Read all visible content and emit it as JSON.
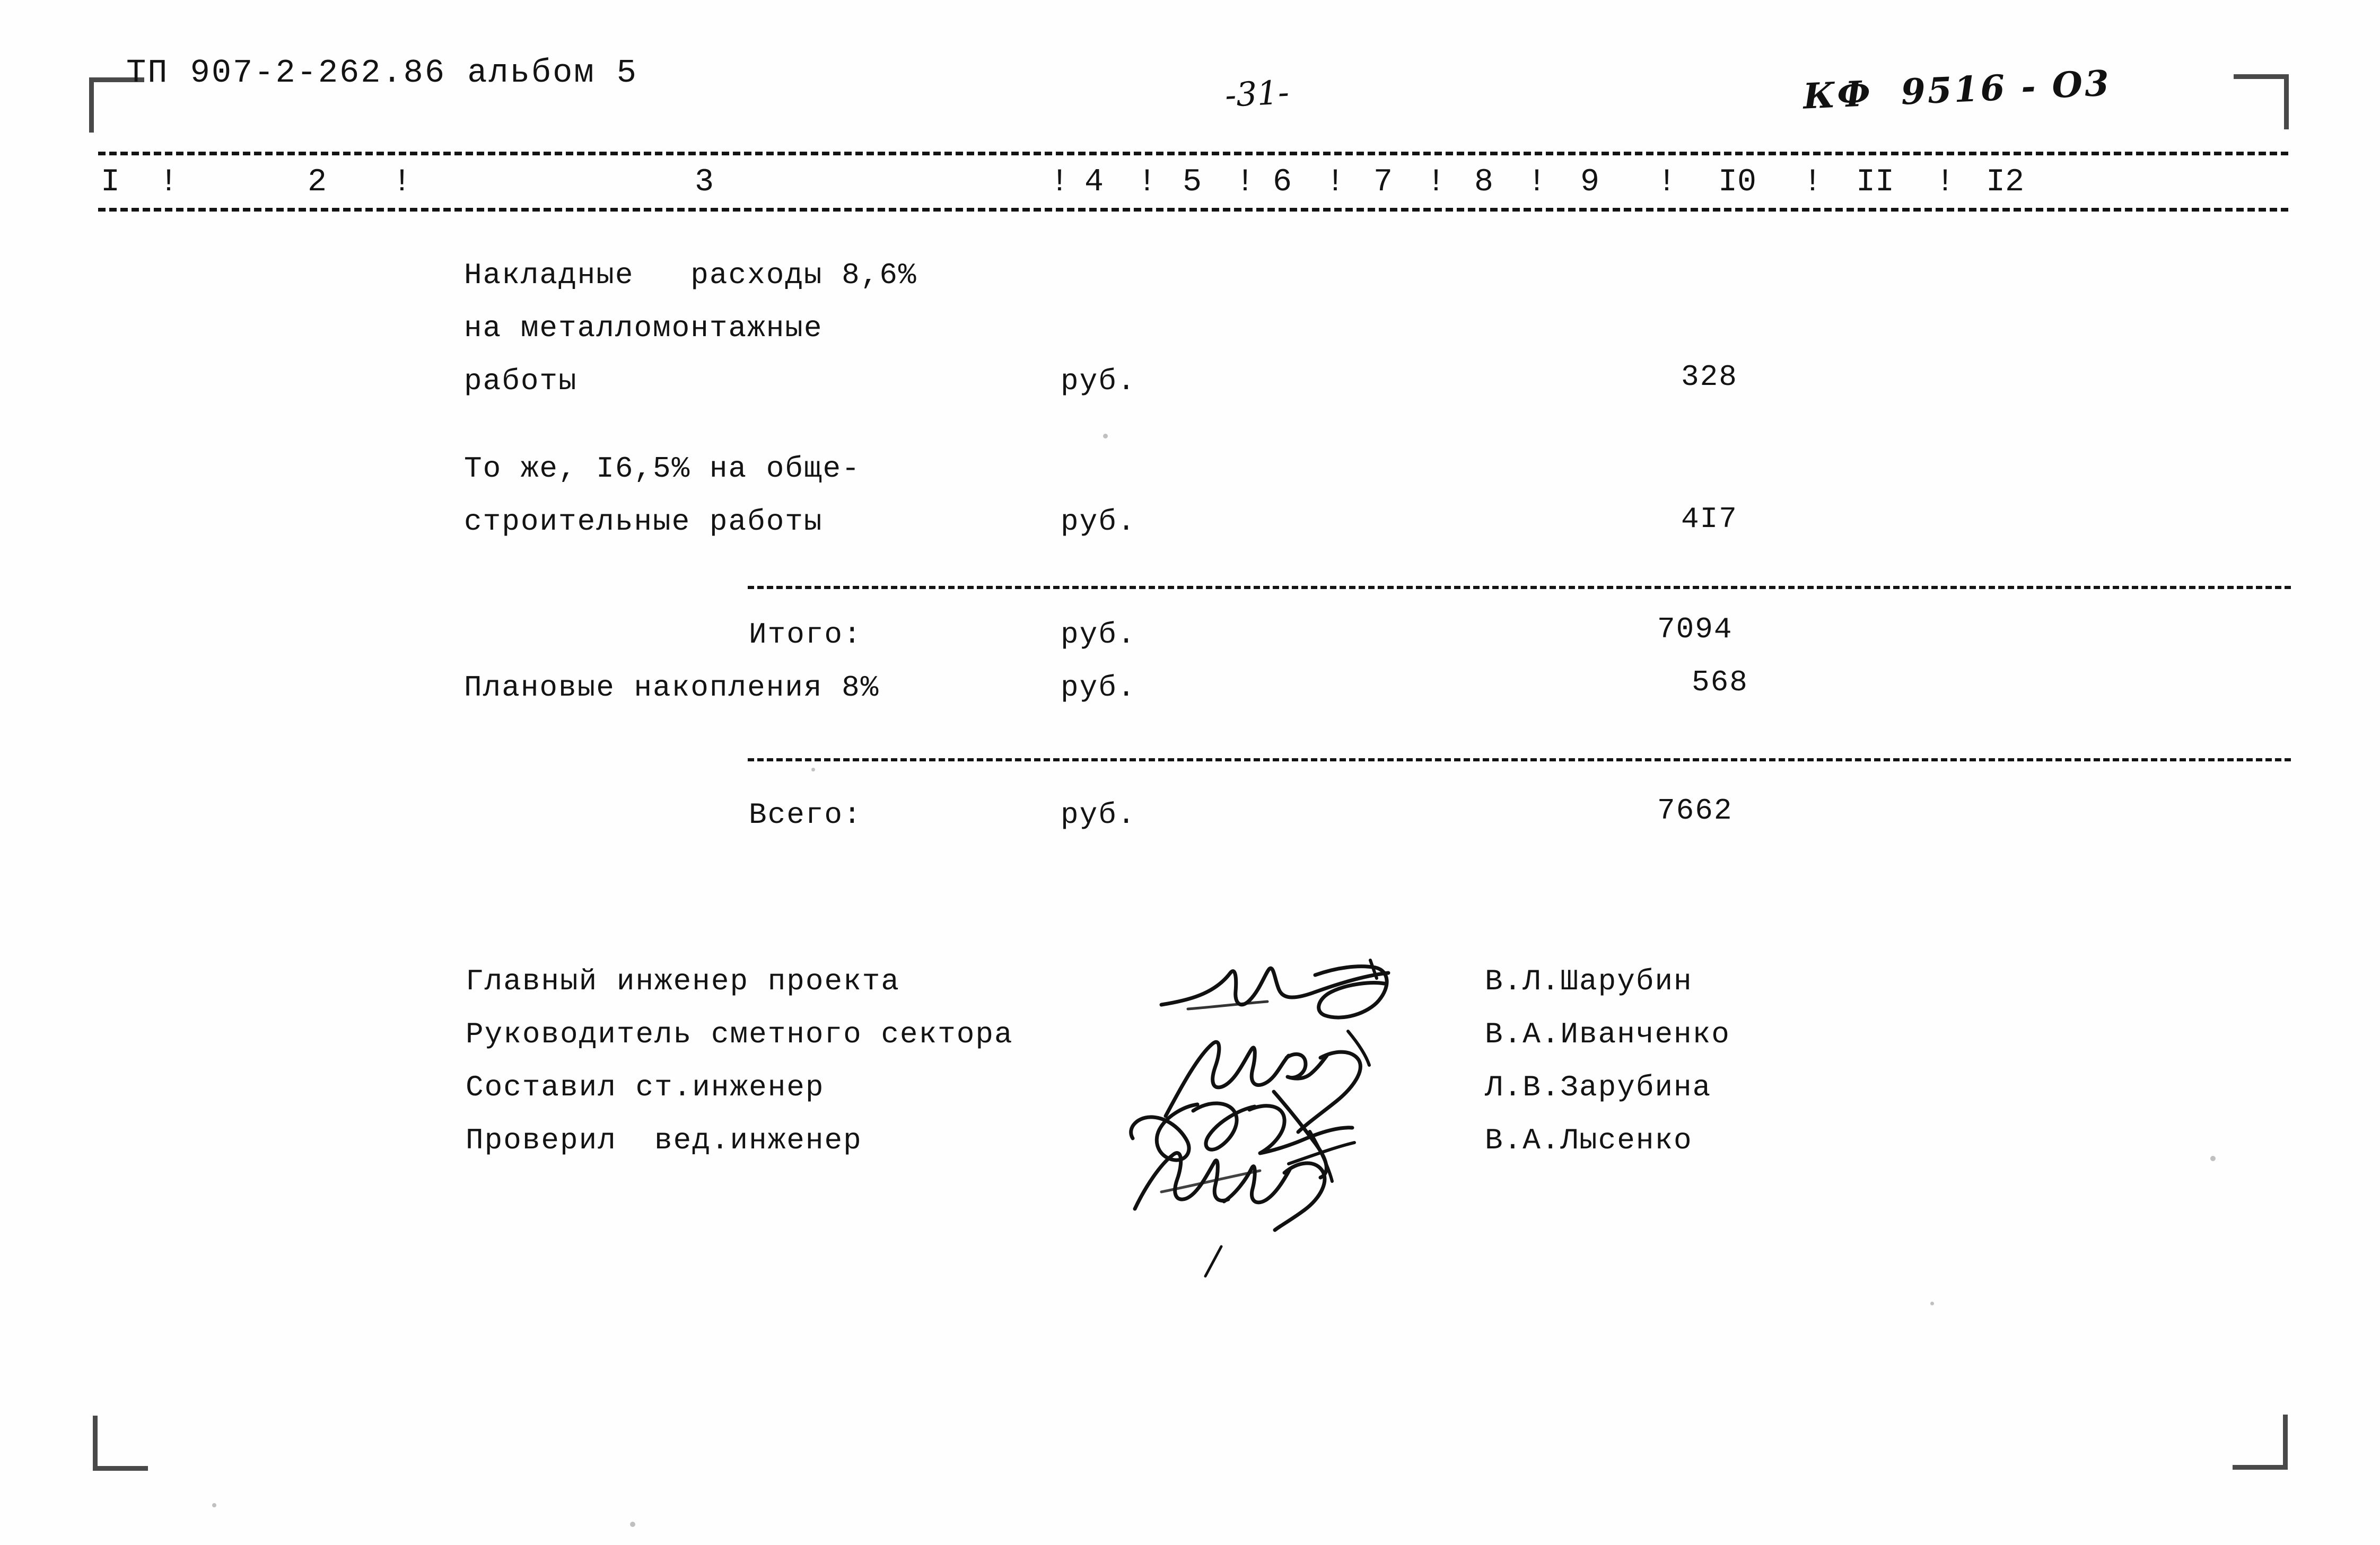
{
  "document": {
    "header_code": "ТП 907-2-262.86 альбом 5",
    "page_number": "-31-",
    "archive_code": "КФ  9516 - О3"
  },
  "table": {
    "column_numbers": [
      "I",
      "2",
      "3",
      "4",
      "5",
      "6",
      "7",
      "8",
      "9",
      "I0",
      "II",
      "I2"
    ],
    "separator": "!",
    "rows": [
      {
        "name": "overhead-metal",
        "description_lines": [
          "Накладные   расходы 8,6%",
          "на металломонтажные",
          "работы"
        ],
        "unit": "руб.",
        "value": "328"
      },
      {
        "name": "overhead-general-construction",
        "description_lines": [
          "То же, I6,5% на обще-",
          "строительные работы"
        ],
        "unit": "руб.",
        "value": "4I7"
      }
    ],
    "subtotal": {
      "label": "Итого:",
      "unit": "руб.",
      "value": "7094"
    },
    "planned_savings": {
      "label": "Плановые накопления 8%",
      "unit": "руб.",
      "value": "568"
    },
    "total": {
      "label": "Всего:",
      "unit": "руб.",
      "value": "7662"
    }
  },
  "signatures": [
    {
      "role": "Главный инженер проекта",
      "person": "В.Л.Шарубин"
    },
    {
      "role": "Руководитель сметного сектора",
      "person": "В.А.Иванченко"
    },
    {
      "role": "Составил ст.инженер",
      "person": "Л.В.Зарубина"
    },
    {
      "role": "Проверил  вед.инженер",
      "person": "В.А.Лысенко"
    }
  ],
  "colors": {
    "ink": "#131313",
    "paper": "#fefefe"
  }
}
